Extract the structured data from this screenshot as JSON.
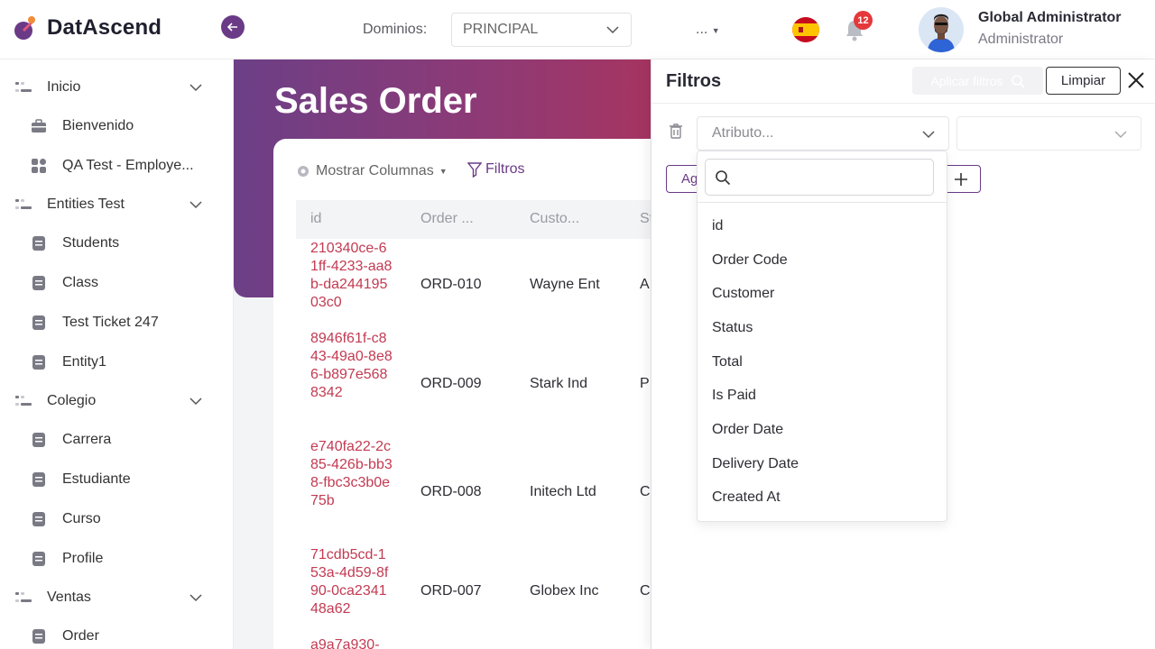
{
  "app": {
    "name": "DatAscend"
  },
  "header": {
    "domain_label": "Dominios:",
    "domain_value": "PRINCIPAL",
    "more_menu": "...",
    "notification_count": "12",
    "user_name": "Global Administrator",
    "user_role": "Administrator"
  },
  "sidebar": {
    "groups": [
      {
        "label": "Inicio",
        "items": [
          "Bienvenido",
          "QA Test - Employe..."
        ]
      },
      {
        "label": "Entities Test",
        "items": [
          "Students",
          "Class",
          "Test Ticket 247",
          "Entity1"
        ]
      },
      {
        "label": "Colegio",
        "items": [
          "Carrera",
          "Estudiante",
          "Curso",
          "Profile"
        ]
      },
      {
        "label": "Ventas",
        "items": [
          "Order"
        ]
      }
    ]
  },
  "main": {
    "title": "Sales Order",
    "toolbar": {
      "columns_label": "Mostrar Columnas",
      "filters_label": "Filtros"
    },
    "table": {
      "headers": [
        "id",
        "Order ...",
        "Custo...",
        "St"
      ],
      "rows": [
        {
          "id": "210340ce-61ff-4233-aa8b-da24419503c0",
          "order": "ORD-010",
          "customer": "Wayne Ent",
          "status": "A"
        },
        {
          "id": "8946f61f-c843-49a0-8e86-b897e5688342",
          "order": "ORD-009",
          "customer": "Stark Ind",
          "status": "P"
        },
        {
          "id": "e740fa22-2c85-426b-bb38-fbc3c3b0e75b",
          "order": "ORD-008",
          "customer": "Initech Ltd",
          "status": "C"
        },
        {
          "id": "71cdb5cd-153a-4d59-8f90-0ca234148a62",
          "order": "ORD-007",
          "customer": "Globex Inc",
          "status": "C"
        },
        {
          "id": "a9a7a930-",
          "order": "",
          "customer": "",
          "status": ""
        }
      ]
    }
  },
  "filter_panel": {
    "title": "Filtros",
    "apply_label": "Aplicar filtros",
    "clear_label": "Limpiar",
    "attribute_placeholder": "Atributo...",
    "add_label": "Ag",
    "dropdown_options": [
      "id",
      "Order Code",
      "Customer",
      "Status",
      "Total",
      "Is Paid",
      "Order Date",
      "Delivery Date",
      "Created At"
    ]
  },
  "colors": {
    "brand": "#6a3a87",
    "id_link": "#c33a52",
    "badge": "#e5383b"
  }
}
